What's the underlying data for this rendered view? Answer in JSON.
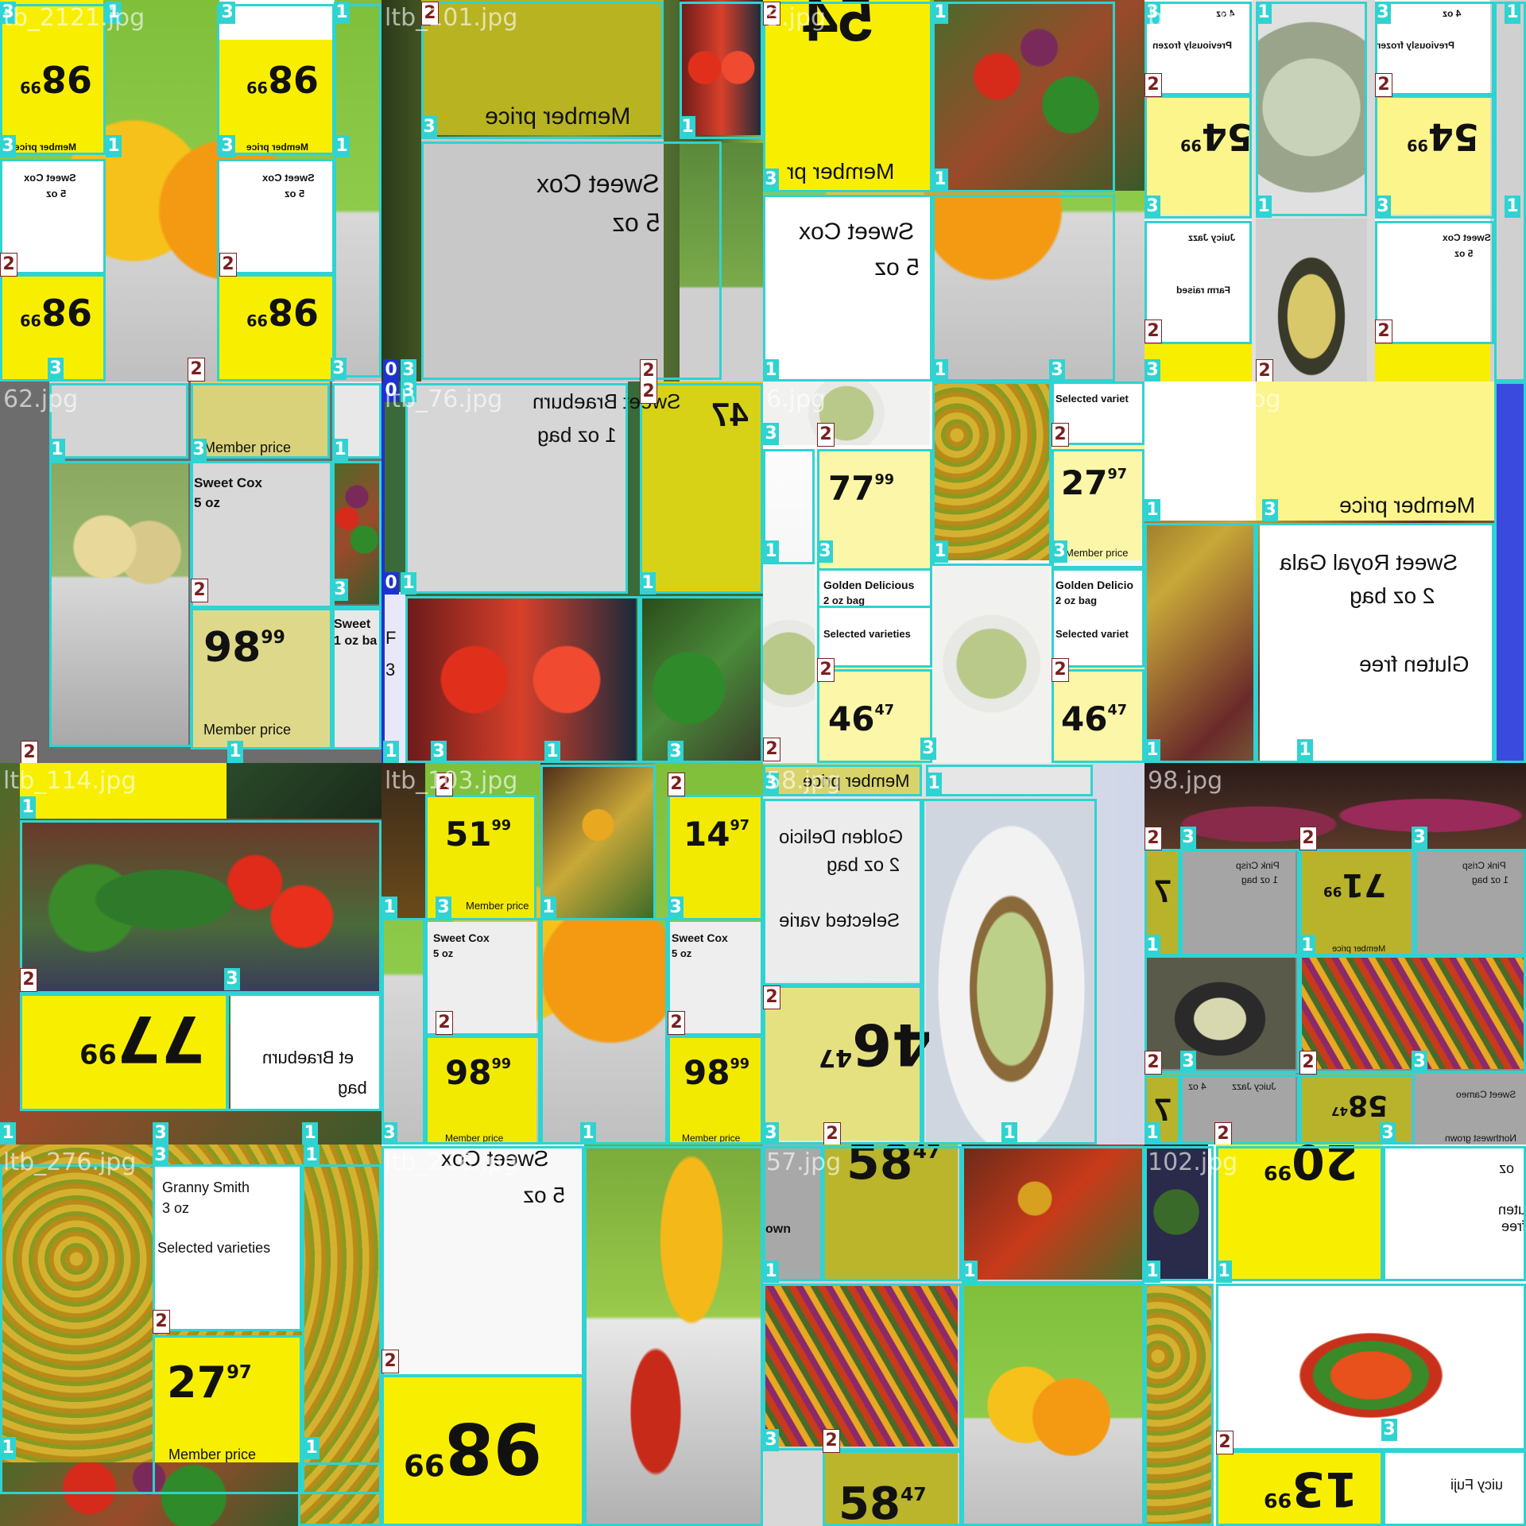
{
  "colors": {
    "box": "#2fd3d1",
    "label0": "#1c33cf",
    "label2": "#7b1f1f",
    "sign_yellow": "#f8ef00",
    "sign_olive": "#b8b320",
    "sign_pale": "#fbf6a8",
    "sign_gray": "#d2d2d2"
  },
  "tiles": [
    {
      "filename": "tb_2121.jpg",
      "texts": [
        "98",
        "99",
        "Member price",
        "Sweet Cox",
        "5 oz",
        "98",
        "99",
        "98",
        "99",
        "Member price",
        "Sweet Cox",
        "5 oz",
        "98",
        "99"
      ]
    },
    {
      "filename": "ltb_101.jpg",
      "texts": [
        "Member price",
        "Sweet Cox",
        "5 oz"
      ]
    },
    {
      "filename": "5.jpg",
      "texts": [
        "54",
        "Member pr",
        "Sweet Cox",
        "5 oz"
      ]
    },
    {
      "filename": "b_61.jpg",
      "texts": [
        "4 oz",
        "Previously frozen",
        "54",
        "99",
        "Juicy Jazz",
        "Farm raised",
        "Previously frozen",
        "54",
        "99",
        "Sweet Cox",
        "5 oz",
        "4 oz"
      ]
    },
    {
      "filename": "62.jpg",
      "texts": [
        "Member price",
        "Sweet Cox",
        "5 oz",
        "98",
        "99",
        "Member price",
        "Sweet",
        "1 oz ba"
      ]
    },
    {
      "filename": "ltb_76.jpg",
      "texts": [
        "Sweet Braeburn",
        "1 oz bag",
        "47",
        "F",
        "3"
      ]
    },
    {
      "filename": "6.jpg",
      "texts": [
        "77",
        "99",
        "Selected variet",
        "27",
        "97",
        "Member price",
        "Golden Delicious",
        "2 oz bag",
        "Selected varieties",
        "46",
        "47",
        "Golden Delicio",
        "2 oz bag",
        "Selected variet",
        "46",
        "47"
      ]
    },
    {
      "filename": "ltb_159.jpg",
      "texts": [
        "Member price",
        "Sweet Royal Gala",
        "2 oz bag",
        "Gluten free"
      ]
    },
    {
      "filename": "ltb_114.jpg",
      "texts": [
        "77",
        "99",
        "et Braeburn",
        "bag"
      ]
    },
    {
      "filename": "ltb_103.jpg",
      "texts": [
        "51",
        "99",
        "Member price",
        "14",
        "97",
        "Sweet Cox",
        "5 oz",
        "Sweet Cox",
        "5 oz",
        "98",
        "99",
        "Member price",
        "98",
        "99",
        "Member price"
      ]
    },
    {
      "filename": "58.jpg",
      "texts": [
        "Member price",
        "Golden Delicio",
        "2 oz bag",
        "Selected varie",
        "46",
        "47"
      ]
    },
    {
      "filename": "98.jpg",
      "texts": [
        "7",
        "M",
        "Pink Crisp",
        "1 oz bag",
        "71",
        "99",
        "Member price",
        "Pink Crisp",
        "1 oz bag",
        "Juicy Jazz",
        "4 oz",
        "7",
        "58",
        "47",
        "Sweet Cameo",
        "Northwest grown"
      ]
    },
    {
      "filename": "ltb_276.jpg",
      "texts": [
        "Granny Smith",
        "3 oz",
        "Selected varieties",
        "27",
        "97",
        "Member price"
      ]
    },
    {
      "filename": "ltb_216.jpg",
      "texts": [
        "Sweet Cox",
        "5 oz",
        "98",
        "99"
      ]
    },
    {
      "filename": "57.jpg",
      "texts": [
        "58",
        "47",
        "own",
        "58",
        "47"
      ]
    },
    {
      "filename": "102.jpg",
      "texts": [
        "20",
        "99",
        "oz",
        "uten free",
        "13",
        "99",
        "uicy Fuji"
      ]
    }
  ],
  "box_labels": [
    "0",
    "1",
    "2",
    "3"
  ]
}
